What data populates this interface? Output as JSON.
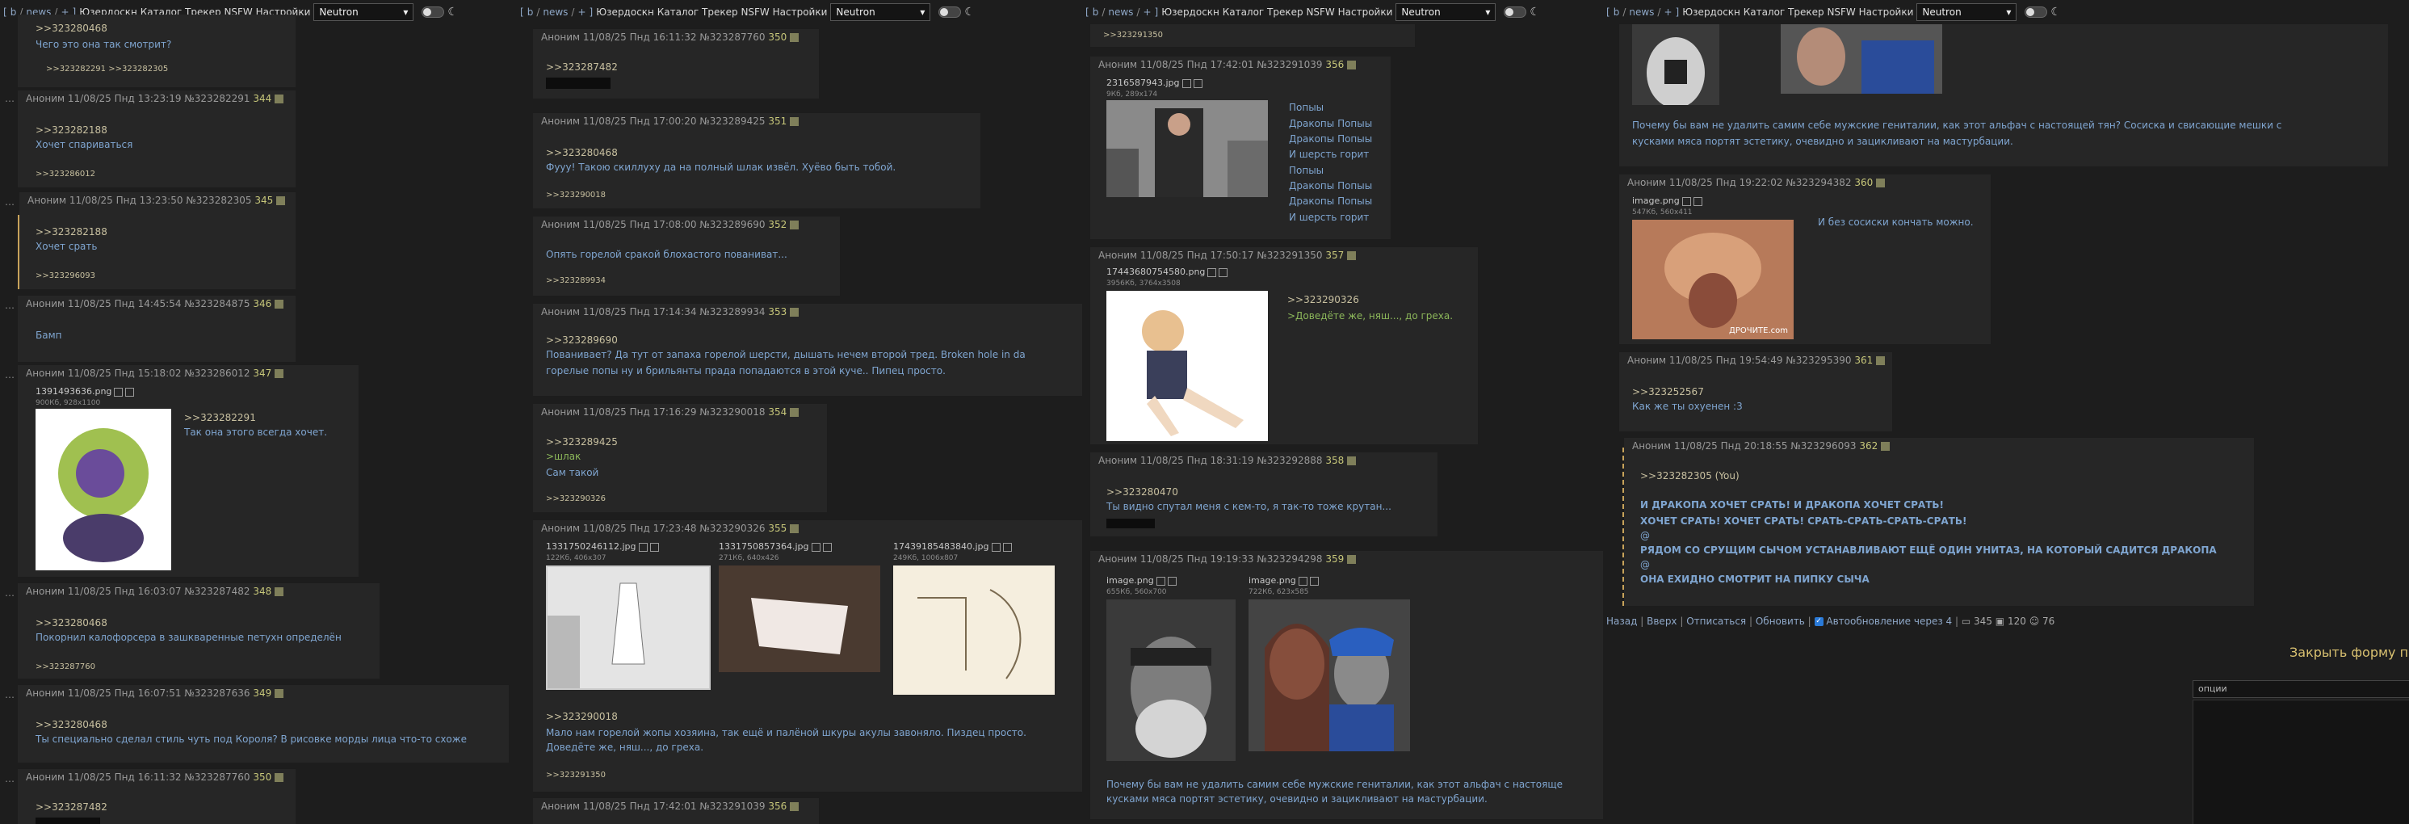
{
  "topbar": {
    "bracket_open": "[",
    "board_b": "b",
    "board_news": "news",
    "plus": "+",
    "bracket_close": "]",
    "links": "Юзердоскн Каталог Трекер NSFW Настройки",
    "theme": "Neutron"
  },
  "col1": {
    "posts": [
      {
        "top_link": ">>323280468",
        "text": "Чего это она так смотрит?",
        "replies": ">>323282291 >>323282305"
      },
      {
        "header": "Аноним 11/08/25 Пнд 13:23:19 №323282291",
        "num": "344",
        "link": ">>323282188",
        "text": "Хочет спариваться",
        "replies": ">>323286012"
      },
      {
        "header": "Аноним 11/08/25 Пнд 13:23:50 №323282305",
        "num": "345",
        "link": ">>323282188",
        "text": "Хочет срать",
        "replies": ">>323296093"
      },
      {
        "header": "Аноним 11/08/25 Пнд 14:45:54 №323284875",
        "num": "346",
        "text": "Бамп"
      },
      {
        "header": "Аноним 11/08/25 Пнд 15:18:02 №323286012",
        "num": "347",
        "file": "1391493636.png",
        "meta": "900Кб, 928x1100",
        "link": ">>323282291",
        "text": "Так она этого всегда хочет."
      },
      {
        "header": "Аноним 11/08/25 Пнд 16:03:07 №323287482",
        "num": "348",
        "link": ">>323280468",
        "text": "Покорнил калофорсера в зашкваренные петухн определён",
        "replies": ">>323287760"
      },
      {
        "header": "Аноним 11/08/25 Пнд 16:07:51 №323287636",
        "num": "349",
        "link": ">>323280468",
        "text": "Ты специально сделал стиль чуть под Короля? В рисовке морды лица что-то схоже"
      },
      {
        "header": "Аноним 11/08/25 Пнд 16:11:32 №323287760",
        "num": "350",
        "link": ">>323287482"
      }
    ]
  },
  "col2": {
    "posts": [
      {
        "header": "Аноним 11/08/25 Пнд 16:11:32 №323287760",
        "num": "350",
        "link": ">>323287482"
      },
      {
        "header": "Аноним 11/08/25 Пнд 17:00:20 №323289425",
        "num": "351",
        "link": ">>323280468",
        "text": "Фууу! Такою скиллуху да на полный шлак извёл. Хуёво быть тобой.",
        "replies": ">>323290018"
      },
      {
        "header": "Аноним 11/08/25 Пнд 17:08:00 №323289690",
        "num": "352",
        "text": "Опять горелой сракой блохастого пованиват...",
        "replies": ">>323289934"
      },
      {
        "header": "Аноним 11/08/25 Пнд 17:14:34 №323289934",
        "num": "353",
        "link": ">>323289690",
        "text": "Пованивает? Да тут от запаха горелой шерсти, дышать нечем второй тред. Broken hole in da",
        "text2": "горелые попы ну и брильянты прада попадаются в этой куче.. Пипец просто."
      },
      {
        "header": "Аноним 11/08/25 Пнд 17:16:29 №323290018",
        "num": "354",
        "link": ">>323289425",
        "green": ">шлак",
        "text": "Сам такой",
        "replies": ">>323290326"
      },
      {
        "header": "Аноним 11/08/25 Пнд 17:23:48 №323290326",
        "num": "355",
        "files": [
          {
            "name": "1331750246112.jpg",
            "meta": "122Кб, 406x307"
          },
          {
            "name": "1331750857364.jpg",
            "meta": "271Кб, 640x426"
          },
          {
            "name": "17439185483840.jpg",
            "meta": "249Кб, 1006x807"
          }
        ],
        "link": ">>323290018",
        "text": "Мало нам горелой жопы хозяина, так ещё и палёной шкуры акулы завоняло. Пиздец просто.",
        "text2": "Доведёте же, няш..., до греха.",
        "replies": ">>323291350"
      },
      {
        "header": "Аноним 11/08/25 Пнд 17:42:01 №323291039",
        "num": "356"
      }
    ]
  },
  "col3": {
    "posts": [
      {
        "replies": ">>323291350"
      },
      {
        "header": "Аноним 11/08/25 Пнд 17:42:01 №323291039",
        "num": "356",
        "file": "2316587943.jpg",
        "meta": "9Кб, 289x174",
        "lines": [
          "Попыы",
          "Дракопы Попыы",
          "Дракопы Попыы",
          "И шерсть горит",
          "Попыы",
          "Дракопы Попыы",
          "Дракопы Попыы",
          "И шерсть горит"
        ]
      },
      {
        "header": "Аноним 11/08/25 Пнд 17:50:17 №323291350",
        "num": "357",
        "file": "17443680754580.png",
        "meta": "3956Кб, 3764x3508",
        "link": ">>323290326",
        "green": ">Доведёте же, няш..., до греха."
      },
      {
        "header": "Аноним 11/08/25 Пнд 18:31:19 №323292888",
        "num": "358",
        "link": ">>323280470",
        "text": "Ты видно спутал меня с кем-то, я так-то тоже крутан..."
      },
      {
        "header": "Аноним 11/08/25 Пнд 19:19:33 №323294298",
        "num": "359",
        "files": [
          {
            "name": "image.png",
            "meta": "655Кб, 560x700"
          },
          {
            "name": "image.png",
            "meta": "722Кб, 623x585"
          }
        ],
        "text": "Почему бы вам не удалить самим себе мужские гениталии, как этот альфач с настояще",
        "text2": "кусками мяса портят эстетику, очевидно и зацикливают на мастурбации."
      }
    ]
  },
  "col4": {
    "posts": [
      {
        "text": "Почему бы вам не удалить самим себе мужские гениталии, как этот альфач с настоящей тян? Сосиска и свисающие мешки с",
        "text2": "кусками мяса портят эстетику, очевидно и зацикливают на мастурбации."
      },
      {
        "header": "Аноним 11/08/25 Пнд 19:22:02 №323294382",
        "num": "360",
        "file": "image.png",
        "meta": "547Кб, 560x411",
        "text": "И без сосиски кончать можно.",
        "watermark": "ДРОЧИТЕ.com"
      },
      {
        "header": "Аноним 11/08/25 Пнд 19:54:49 №323295390",
        "num": "361",
        "link": ">>323252567",
        "text": "Как же ты охуенен :3"
      },
      {
        "header": "Аноним 11/08/25 Пнд 20:18:55 №323296093",
        "num": "362",
        "link": ">>323282305 (You)",
        "bold": [
          "И ДРАКОПА ХОЧЕТ СРАТЬ! И ДРАКОПА ХОЧЕТ СРАТЬ!",
          "ХОЧЕТ СРАТЬ! ХОЧЕТ СРАТЬ! СРАТЬ-СРАТЬ-СРАТЬ-СРАТЬ!",
          "@",
          "РЯДОМ СО СРУЩИМ СЫЧОМ УСТАНАВЛИВАЮТ ЕЩЁ ОДИН УНИТАЗ, НА КОТОРЫЙ САДИТСЯ ДРАКОПА",
          "@",
          "ОНА ЕХИДНО СМОТРИТ НА ПИПКУ СЫЧА"
        ]
      }
    ],
    "bottom": {
      "back": "Назад",
      "sep": "|",
      "up": "Вверх",
      "unsub": "Отписаться",
      "refresh": "Обновить",
      "auto": "Автообновление через 4",
      "posts": "345",
      "files": "120",
      "users": "76"
    },
    "close_form": "Закрыть форму п",
    "options_placeholder": "опции"
  },
  "colors": {
    "bg": "#1d1d1d",
    "post": "#262626",
    "text": "#7fa5d0",
    "number": "#c7c77a",
    "greentext": "#8cb75a"
  }
}
